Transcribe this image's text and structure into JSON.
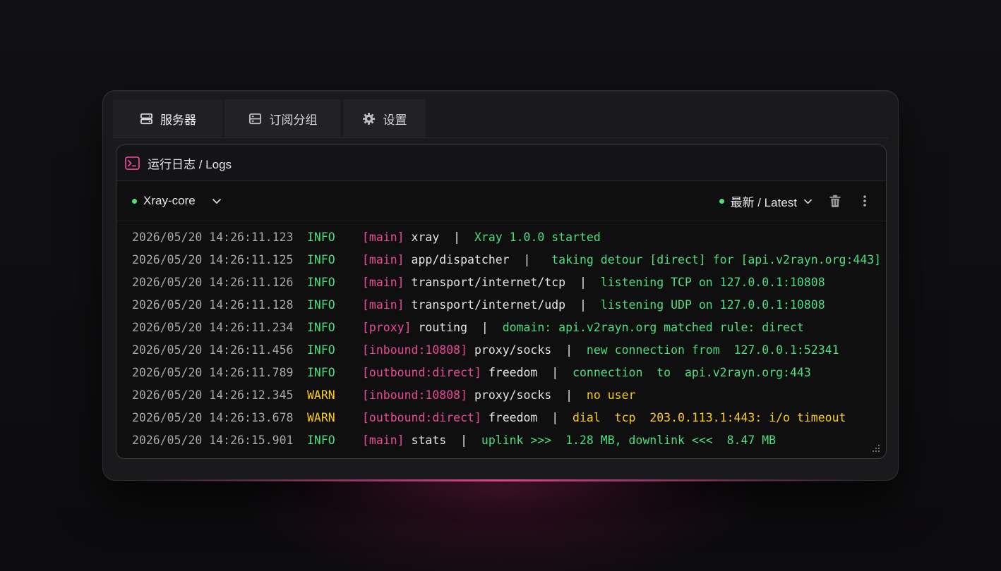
{
  "tabs": [
    {
      "label": "服务器",
      "icon": "server-icon",
      "active": true
    },
    {
      "label": "订阅分组",
      "icon": "subscription-group-icon",
      "active": false
    },
    {
      "label": "设置",
      "icon": "gear-icon",
      "active": false
    }
  ],
  "panel": {
    "title": "运行日志 / Logs",
    "icon": "terminal-icon"
  },
  "toolbar": {
    "core_label": "Xray-core",
    "core_status_color": "#4ade80",
    "sort_label": "最新 / Latest",
    "sort_status_color": "#4ade80"
  },
  "logs": [
    {
      "ts": "2026/05/20 14:26:11.123",
      "level": "INFO",
      "tag": "[main]",
      "module": "xray",
      "msg": "Xray 1.0.0 started"
    },
    {
      "ts": "2026/05/20 14:26:11.125",
      "level": "INFO",
      "tag": "[main]",
      "module": "app/dispatcher",
      "msg": " taking detour [direct] for [api.v2rayn.org:443]"
    },
    {
      "ts": "2026/05/20 14:26:11.126",
      "level": "INFO",
      "tag": "[main]",
      "module": "transport/internet/tcp",
      "msg": "listening TCP on 127.0.0.1:10808"
    },
    {
      "ts": "2026/05/20 14:26:11.128",
      "level": "INFO",
      "tag": "[main]",
      "module": "transport/internet/udp",
      "msg": "listening UDP on 127.0.0.1:10808"
    },
    {
      "ts": "2026/05/20 14:26:11.234",
      "level": "INFO",
      "tag": "[proxy]",
      "module": "routing",
      "msg": "domain: api.v2rayn.org matched rule: direct"
    },
    {
      "ts": "2026/05/20 14:26:11.456",
      "level": "INFO",
      "tag": "[inbound:10808]",
      "module": "proxy/socks",
      "msg": "new connection from  127.0.0.1:52341"
    },
    {
      "ts": "2026/05/20 14:26:11.789",
      "level": "INFO",
      "tag": "[outbound:direct]",
      "module": "freedom",
      "msg": "connection  to  api.v2rayn.org:443"
    },
    {
      "ts": "2026/05/20 14:26:12.345",
      "level": "WARN",
      "tag": "[inbound:10808]",
      "module": "proxy/socks",
      "msg": "no user"
    },
    {
      "ts": "2026/05/20 14:26:13.678",
      "level": "WARN",
      "tag": "[outbound:direct]",
      "module": "freedom",
      "msg": "dial  tcp  203.0.113.1:443: i/o timeout"
    },
    {
      "ts": "2026/05/20 14:26:15.901",
      "level": "INFO",
      "tag": "[main]",
      "module": "stats",
      "msg": "uplink >>>  1.28 MB, downlink <<<  8.47 MB"
    }
  ],
  "colors": {
    "accent": "#ec4899",
    "info": "#4ade80",
    "warn": "#facc15"
  }
}
